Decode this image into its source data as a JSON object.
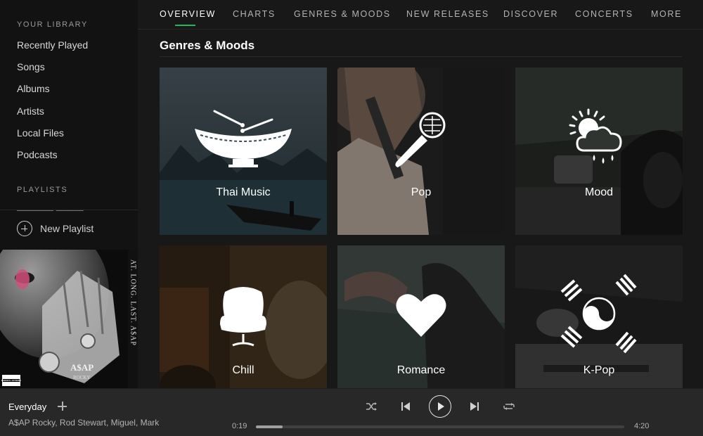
{
  "sidebar": {
    "library_title": "YOUR LIBRARY",
    "library_items": [
      "Recently Played",
      "Songs",
      "Albums",
      "Artists",
      "Local Files",
      "Podcasts"
    ],
    "playlists_title": "PLAYLISTS",
    "new_playlist_label": "New Playlist"
  },
  "album_art": {
    "side_text": "AT. LONG. LAST. A$AP",
    "cover_text_1": "A$AP",
    "cover_text_2": "ROCKY",
    "advisory_text": "PARENTAL ADVISORY"
  },
  "topnav": {
    "tabs": [
      "OVERVIEW",
      "CHARTS",
      "GENRES & MOODS",
      "NEW RELEASES",
      "DISCOVER",
      "CONCERTS",
      "MORE"
    ],
    "active_tab": "OVERVIEW"
  },
  "main": {
    "heading": "Genres & Moods",
    "tiles": [
      {
        "label": "Thai Music",
        "icon": "thai-drum-icon"
      },
      {
        "label": "Pop",
        "icon": "microphone-icon"
      },
      {
        "label": "Mood",
        "icon": "sun-cloud-rain-icon"
      },
      {
        "label": "Chill",
        "icon": "armchair-icon"
      },
      {
        "label": "Romance",
        "icon": "heart-icon"
      },
      {
        "label": "K-Pop",
        "icon": "korean-flag-icon"
      }
    ]
  },
  "player": {
    "track_title": "Everyday",
    "track_artists": "A$AP Rocky, Rod Stewart, Miguel, Mark",
    "elapsed": "0:19",
    "duration": "4:20",
    "progress_fraction": 0.073
  },
  "colors": {
    "accent": "#1db954",
    "sidebar_bg": "#121212",
    "main_bg": "#181818",
    "player_bg": "#282828"
  }
}
